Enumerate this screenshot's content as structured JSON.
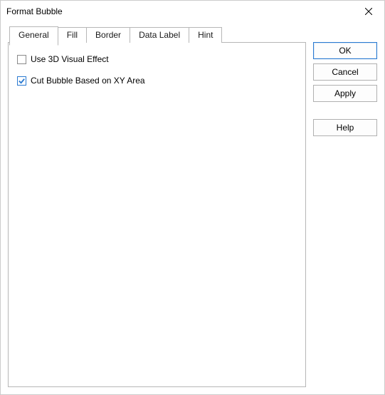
{
  "window": {
    "title": "Format Bubble"
  },
  "tabs": {
    "general": "General",
    "fill": "Fill",
    "border": "Border",
    "data_label": "Data Label",
    "hint": "Hint"
  },
  "general_panel": {
    "use_3d_label": "Use 3D Visual Effect",
    "use_3d_checked": false,
    "cut_bubble_label": "Cut Bubble Based on XY Area",
    "cut_bubble_checked": true
  },
  "buttons": {
    "ok": "OK",
    "cancel": "Cancel",
    "apply": "Apply",
    "help": "Help"
  }
}
